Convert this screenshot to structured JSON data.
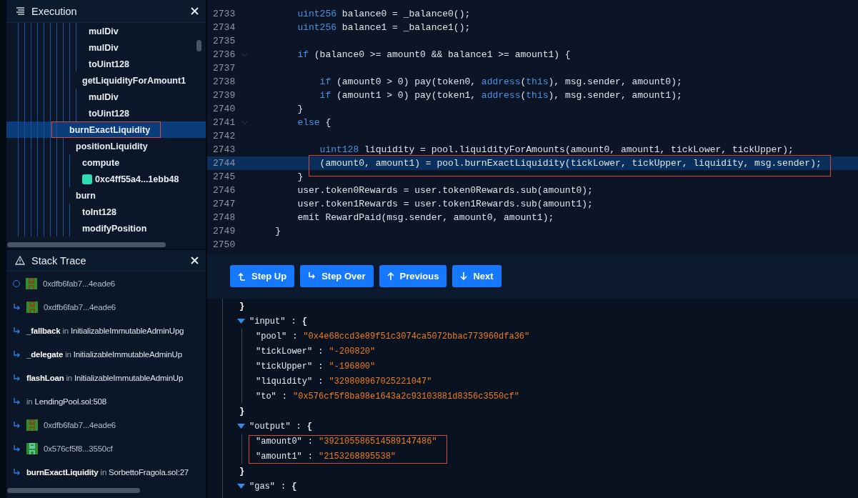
{
  "execution": {
    "title": "Execution",
    "tree": [
      {
        "children": [
          {
            "children": [
              {
                "children": [
                  {
                    "label": "mulDiv",
                    "selected": false,
                    "boxed": false
                  },
                  {
                    "label": "mulDiv",
                    "selected": false,
                    "boxed": false
                  },
                  {
                    "label": "toUint128",
                    "selected": false,
                    "boxed": false
                  }
                ]
              },
              {
                "label": "getLiquidityForAmount1",
                "selected": false,
                "boxed": false,
                "children": [
                  {
                    "label": "mulDiv",
                    "selected": false,
                    "boxed": false
                  },
                  {
                    "label": "toUint128",
                    "selected": false,
                    "boxed": false
                  }
                ]
              }
            ]
          }
        ]
      },
      {
        "label": "burnExactLiquidity",
        "selected": true,
        "boxed": true,
        "children": [
          {
            "label": "positionLiquidity",
            "selected": false,
            "boxed": false,
            "children": [
              {
                "label": "compute",
                "selected": false,
                "boxed": false
              },
              {
                "label": "0xc4ff55a4...1ebb48",
                "kind": "contract",
                "selected": false,
                "boxed": false
              }
            ]
          },
          {
            "label": "burn",
            "selected": false,
            "boxed": false,
            "children": [
              {
                "label": "toInt128",
                "selected": false,
                "boxed": false
              },
              {
                "label": "modifyPosition",
                "selected": false,
                "boxed": false
              }
            ]
          }
        ]
      }
    ]
  },
  "stack_trace": {
    "title": "Stack Trace",
    "rows": [
      {
        "kind": "address",
        "current": true,
        "address": "0xdfb6fab7...4eade6",
        "color": "#7a4f1c"
      },
      {
        "kind": "address",
        "current": false,
        "address": "0xdfb6fab7...4eade6",
        "color": "#7a4f1c"
      },
      {
        "kind": "function",
        "current": false,
        "function": "_fallback",
        "in": "in",
        "location": "InitializableImmutableAdminUpg"
      },
      {
        "kind": "function",
        "current": false,
        "function": "_delegate",
        "in": "in",
        "location": "InitializableImmutableAdminUp"
      },
      {
        "kind": "function",
        "current": false,
        "function": "flashLoan",
        "in": "in",
        "location": "InitializableImmutableAdminUp"
      },
      {
        "kind": "function",
        "current": false,
        "in": "in",
        "location": "LendingPool.sol:508"
      },
      {
        "kind": "address",
        "current": false,
        "address": "0xdfb6fab7...4eade6",
        "color": "#7a4f1c"
      },
      {
        "kind": "address",
        "current": false,
        "address": "0x576cf5f8...3550cf",
        "color": "#5fc9a6"
      },
      {
        "kind": "function",
        "current": false,
        "function": "burnExactLiquidity",
        "in": "in",
        "location": "SorbettoFragola.sol:27"
      }
    ]
  },
  "code": {
    "lines": [
      {
        "n": "2733",
        "foldable": false,
        "current": false,
        "boxed": false,
        "tokens": [
          {
            "t": "        uint256",
            "kind": "kw"
          },
          {
            "t": " balance0 = _balance0();",
            "kind": "text"
          }
        ]
      },
      {
        "n": "2734",
        "foldable": false,
        "current": false,
        "boxed": false,
        "tokens": [
          {
            "t": "        uint256",
            "kind": "kw"
          },
          {
            "t": " balance1 = _balance1();",
            "kind": "text"
          }
        ]
      },
      {
        "n": "2735",
        "foldable": false,
        "current": false,
        "boxed": false
      },
      {
        "n": "2736",
        "foldable": true,
        "current": false,
        "boxed": false,
        "tokens": [
          {
            "t": "        if",
            "kind": "kw"
          },
          {
            "t": " (balance0 >= amount0 && balance1 >= amount1) {",
            "kind": "text"
          }
        ]
      },
      {
        "n": "2737",
        "foldable": false,
        "current": false,
        "boxed": false
      },
      {
        "n": "2738",
        "foldable": false,
        "current": false,
        "boxed": false,
        "tokens": [
          {
            "t": "            if",
            "kind": "kw"
          },
          {
            "t": " (amount0 > 0) pay(token0, ",
            "kind": "text"
          },
          {
            "t": "address",
            "kind": "kw"
          },
          {
            "t": "(",
            "kind": "text"
          },
          {
            "t": "this",
            "kind": "kw"
          },
          {
            "t": "), msg.sender, amount0);",
            "kind": "text"
          }
        ]
      },
      {
        "n": "2739",
        "foldable": false,
        "current": false,
        "boxed": false,
        "tokens": [
          {
            "t": "            if",
            "kind": "kw"
          },
          {
            "t": " (amount1 > 0) pay(token1, ",
            "kind": "text"
          },
          {
            "t": "address",
            "kind": "kw"
          },
          {
            "t": "(",
            "kind": "text"
          },
          {
            "t": "this",
            "kind": "kw"
          },
          {
            "t": "), msg.sender, amount1);",
            "kind": "text"
          }
        ]
      },
      {
        "n": "2740",
        "foldable": false,
        "current": false,
        "boxed": false,
        "tokens": [
          {
            "t": "        }",
            "kind": "text"
          }
        ]
      },
      {
        "n": "2741",
        "foldable": true,
        "current": false,
        "boxed": false,
        "tokens": [
          {
            "t": "        else",
            "kind": "kw"
          },
          {
            "t": " {",
            "kind": "text"
          }
        ]
      },
      {
        "n": "2742",
        "foldable": false,
        "current": false,
        "boxed": false
      },
      {
        "n": "2743",
        "foldable": false,
        "current": false,
        "boxed": false,
        "tokens": [
          {
            "t": "            uint128",
            "kind": "kw"
          },
          {
            "t": " liquidity = pool.liquidityForAmounts(amount0, amount1, tickLower, tickUpper);",
            "kind": "text"
          }
        ]
      },
      {
        "n": "2744",
        "foldable": false,
        "current": true,
        "boxed": true,
        "tokens": [
          {
            "t": "            (amount0, amount1) = pool.burnExactLiquidity(tickLower, tickUpper, liquidity, msg.sender);",
            "kind": "text"
          }
        ]
      },
      {
        "n": "2745",
        "foldable": false,
        "current": false,
        "boxed": false,
        "tokens": [
          {
            "t": "        }",
            "kind": "text"
          }
        ]
      },
      {
        "n": "2746",
        "foldable": false,
        "current": false,
        "boxed": false,
        "tokens": [
          {
            "t": "        user.token0Rewards = user.token0Rewards.sub(amount0);",
            "kind": "text"
          }
        ]
      },
      {
        "n": "2747",
        "foldable": false,
        "current": false,
        "boxed": false,
        "tokens": [
          {
            "t": "        user.token1Rewards = user.token1Rewards.sub(amount1);",
            "kind": "text"
          }
        ]
      },
      {
        "n": "2748",
        "foldable": false,
        "current": false,
        "boxed": false,
        "tokens": [
          {
            "t": "        emit RewardPaid(msg.sender, amount0, amount1);",
            "kind": "text"
          }
        ]
      },
      {
        "n": "2749",
        "foldable": false,
        "current": false,
        "boxed": false,
        "tokens": [
          {
            "t": "    }",
            "kind": "text"
          }
        ]
      },
      {
        "n": "2750",
        "foldable": false,
        "current": false,
        "boxed": false
      }
    ]
  },
  "buttons": [
    {
      "kind": "step-up",
      "label": "Step Up"
    },
    {
      "kind": "step-over",
      "label": "Step Over"
    },
    {
      "kind": "previous",
      "label": "Previous"
    },
    {
      "kind": "next",
      "label": "Next"
    }
  ],
  "json_view": {
    "lines": [
      {
        "kind": "close",
        "text": "}"
      },
      {
        "kind": "group",
        "key": "\"input\"",
        "sep": ":",
        "open": "{",
        "expanded": true,
        "boxed": false,
        "close": "}",
        "entries": [
          {
            "key": "\"pool\"",
            "sep": ":",
            "value": "\"0x4e68ccd3e89f51c3074ca5072bbac773960dfa36\""
          },
          {
            "key": "\"tickLower\"",
            "sep": ":",
            "value": "\"-200820\""
          },
          {
            "key": "\"tickUpper\"",
            "sep": ":",
            "value": "\"-196800\""
          },
          {
            "key": "\"liquidity\"",
            "sep": ":",
            "value": "\"329808967025221047\""
          },
          {
            "key": "\"to\"",
            "sep": ":",
            "value": "\"0x576cf5f8ba98e1643a2c93103881d8356c3550cf\""
          }
        ]
      },
      {
        "kind": "group",
        "key": "\"output\"",
        "sep": ":",
        "open": "{",
        "expanded": true,
        "boxed": true,
        "close": "}",
        "entries": [
          {
            "key": "\"amount0\"",
            "sep": ":",
            "value": "\"392105586514589147486\""
          },
          {
            "key": "\"amount1\"",
            "sep": ":",
            "value": "\"2153268895538\""
          }
        ]
      },
      {
        "kind": "group",
        "key": "\"gas\"",
        "sep": ":",
        "open": "{",
        "expanded": true,
        "boxed": false
      }
    ]
  }
}
